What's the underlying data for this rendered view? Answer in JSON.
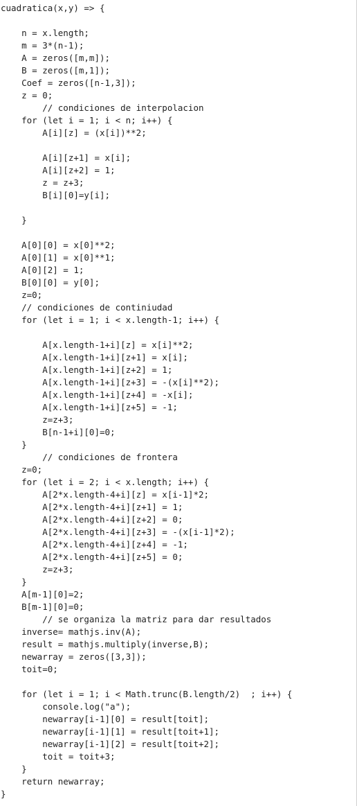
{
  "code_lines": [
    "cuadratica(x,y) => {",
    "",
    "    n = x.length;",
    "    m = 3*(n-1);",
    "    A = zeros([m,m]);",
    "    B = zeros([m,1]);",
    "    Coef = zeros([n-1,3]);",
    "    z = 0;",
    "        // condiciones de interpolacion",
    "    for (let i = 1; i < n; i++) {",
    "        A[i][z] = (x[i])**2;",
    "",
    "        A[i][z+1] = x[i];",
    "        A[i][z+2] = 1;",
    "        z = z+3;",
    "        B[i][0]=y[i];",
    "",
    "    }",
    "",
    "    A[0][0] = x[0]**2;",
    "    A[0][1] = x[0]**1;",
    "    A[0][2] = 1;",
    "    B[0][0] = y[0];",
    "    z=0;",
    "    // condiciones de continiudad",
    "    for (let i = 1; i < x.length-1; i++) {",
    "",
    "        A[x.length-1+i][z] = x[i]**2;",
    "        A[x.length-1+i][z+1] = x[i];",
    "        A[x.length-1+i][z+2] = 1;",
    "        A[x.length-1+i][z+3] = -(x[i]**2);",
    "        A[x.length-1+i][z+4] = -x[i];",
    "        A[x.length-1+i][z+5] = -1;",
    "        z=z+3;",
    "        B[n-1+i][0]=0;",
    "    }",
    "        // condiciones de frontera",
    "    z=0;",
    "    for (let i = 2; i < x.length; i++) {",
    "        A[2*x.length-4+i][z] = x[i-1]*2;",
    "        A[2*x.length-4+i][z+1] = 1;",
    "        A[2*x.length-4+i][z+2] = 0;",
    "        A[2*x.length-4+i][z+3] = -(x[i-1]*2);",
    "        A[2*x.length-4+i][z+4] = -1;",
    "        A[2*x.length-4+i][z+5] = 0;",
    "        z=z+3;",
    "    }",
    "    A[m-1][0]=2;",
    "    B[m-1][0]=0;",
    "        // se organiza la matriz para dar resultados",
    "    inverse= mathjs.inv(A);",
    "    result = mathjs.multiply(inverse,B);",
    "    newarray = zeros([3,3]);",
    "    toit=0;",
    "",
    "    for (let i = 1; i < Math.trunc(B.length/2)  ; i++) {",
    "        console.log(\"a\");",
    "        newarray[i-1][0] = result[toit];",
    "        newarray[i-1][1] = result[toit+1];",
    "        newarray[i-1][2] = result[toit+2];",
    "        toit = toit+3;",
    "    }",
    "    return newarray;",
    "}"
  ]
}
